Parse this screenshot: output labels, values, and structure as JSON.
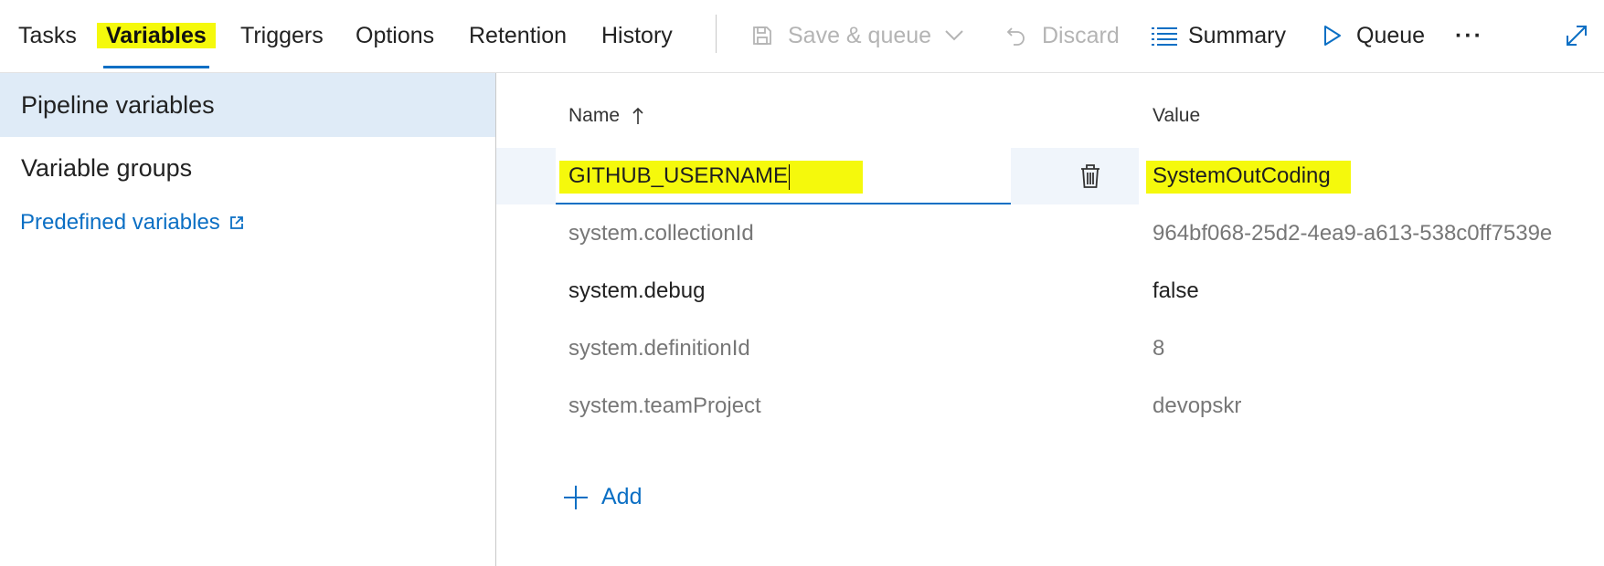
{
  "tabs": [
    {
      "label": "Tasks",
      "active": false
    },
    {
      "label": "Variables",
      "active": true
    },
    {
      "label": "Triggers",
      "active": false
    },
    {
      "label": "Options",
      "active": false
    },
    {
      "label": "Retention",
      "active": false
    },
    {
      "label": "History",
      "active": false
    }
  ],
  "toolbar": {
    "save_queue": {
      "label": "Save & queue",
      "icon": "save-icon",
      "enabled": false
    },
    "discard": {
      "label": "Discard",
      "icon": "undo-icon",
      "enabled": false
    },
    "summary": {
      "label": "Summary",
      "icon": "list-icon"
    },
    "queue": {
      "label": "Queue",
      "icon": "play-icon"
    },
    "more": {
      "label": "···",
      "icon": "ellipsis-icon"
    },
    "expand": {
      "icon": "expand-icon"
    }
  },
  "left_panel": {
    "items": [
      {
        "label": "Pipeline variables",
        "selected": true
      },
      {
        "label": "Variable groups",
        "selected": false
      }
    ],
    "link": {
      "label": "Predefined variables",
      "icon": "external-link-icon"
    }
  },
  "table": {
    "columns": {
      "name": "Name",
      "sort_icon": "arrow-up-icon",
      "value": "Value"
    },
    "editing_row": {
      "name": "GITHUB_USERNAME",
      "value": "SystemOutCoding",
      "delete_icon": "trash-icon"
    },
    "rows": [
      {
        "name": "system.collectionId",
        "value": "964bf068-25d2-4ea9-a613-538c0ff7539e",
        "readonly": true
      },
      {
        "name": "system.debug",
        "value": "false",
        "readonly": false
      },
      {
        "name": "system.definitionId",
        "value": "8",
        "readonly": true
      },
      {
        "name": "system.teamProject",
        "value": "devopskr",
        "readonly": true
      }
    ],
    "add": {
      "label": "Add",
      "icon": "plus-icon"
    }
  },
  "colors": {
    "accent": "#0b6fc4",
    "highlight": "#f5f90c",
    "selected_bg": "#dfebf7"
  }
}
